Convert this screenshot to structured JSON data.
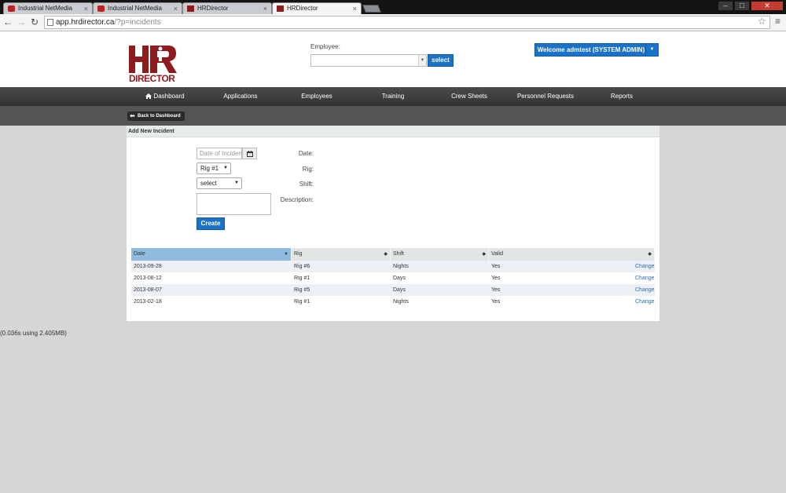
{
  "browser": {
    "tabs": [
      {
        "title": "Industrial NetMedia",
        "active": false,
        "favicon": "industrial-netmedia-icon"
      },
      {
        "title": "Industrial NetMedia",
        "active": false,
        "favicon": "industrial-netmedia-icon"
      },
      {
        "title": "HRDirector",
        "active": false,
        "favicon": "hrdirector-icon"
      },
      {
        "title": "HRDirector",
        "active": true,
        "favicon": "hrdirector-icon"
      }
    ],
    "tab_close": "×",
    "url_host": "app.hrdirector.ca",
    "url_path": "/?p=incidents"
  },
  "header": {
    "logo_text": "DIRECTOR",
    "employee_label": "Employee:",
    "employee_select_button": "select",
    "welcome_prefix": "Welcome ",
    "welcome_user": "admtest",
    "welcome_suffix": " (SYSTEM ADMIN)"
  },
  "nav": {
    "items": [
      "Dashboard",
      "Applications",
      "Employees",
      "Training",
      "Crew Sheets",
      "Personnel Requests",
      "Reports"
    ]
  },
  "subnav": {
    "back_label": "Back to Dashboard"
  },
  "form": {
    "section_title": "Add New Incident",
    "date_label": "Date:",
    "date_placeholder": "Date of Incident",
    "rig_label": "Rig:",
    "rig_value": "Rig #1",
    "shift_label": "Shift:",
    "shift_value": "select",
    "description_label": "Description:",
    "create_label": "Create"
  },
  "table": {
    "columns": [
      "Date",
      "Rig",
      "Shift",
      "Valid",
      ""
    ],
    "sorted_column": "Date",
    "rows": [
      {
        "date": "2013-09-28",
        "rig": "Rig #6",
        "shift": "Nights",
        "valid": "Yes",
        "action": "Change"
      },
      {
        "date": "2013-08-12",
        "rig": "Rig #1",
        "shift": "Days",
        "valid": "Yes",
        "action": "Change"
      },
      {
        "date": "2013-08-07",
        "rig": "Rig #5",
        "shift": "Days",
        "valid": "Yes",
        "action": "Change"
      },
      {
        "date": "2013-02-18",
        "rig": "Rig #1",
        "shift": "Nights",
        "valid": "Yes",
        "action": "Change"
      }
    ]
  },
  "footer": {
    "stats": "(0.036s using 2.405MB)"
  },
  "colors": {
    "brand_red": "#8e1b1e",
    "accent_blue": "#1a73c9",
    "nav_dark": "#3a3a3a"
  }
}
